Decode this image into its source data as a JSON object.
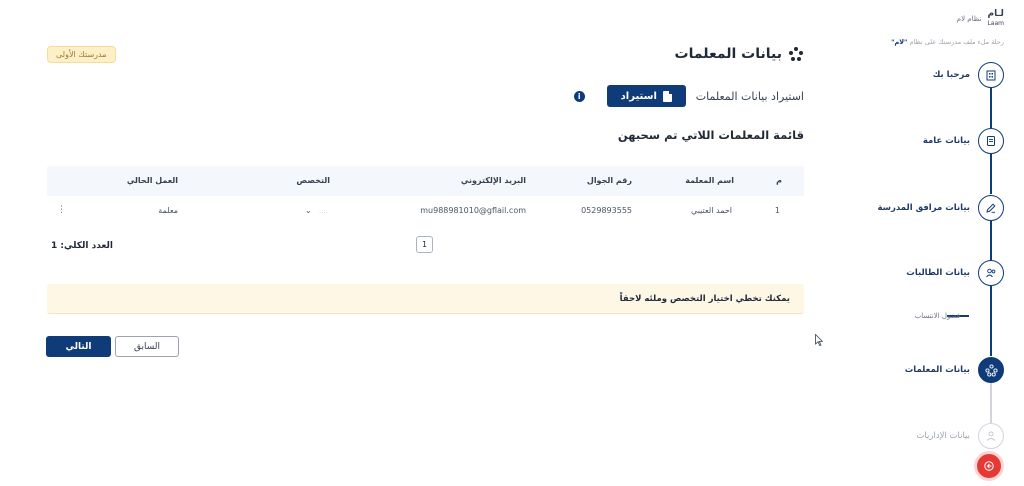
{
  "header": {
    "school_badge": "مدرستك الأولى",
    "page_title": "بيانات المعلمات"
  },
  "import": {
    "label": "استيراد بيانات المعلمات",
    "button": "استيراد"
  },
  "list_title": "قائمة المعلمات اللاتي تم سحبهن",
  "table": {
    "headers": {
      "index": "م",
      "name": "اسم المعلمة",
      "mobile": "رقم الجوال",
      "email": "البريد الإلكتروني",
      "specialty": "التخصص",
      "current_job": "العمل الحالي"
    },
    "rows": [
      {
        "index": "1",
        "name": "احمد العتيبي",
        "mobile": "0529893555",
        "email": "mu988981010@gflail.com",
        "specialty_placeholder": "....",
        "current_job": "معلمة"
      }
    ]
  },
  "pagination": {
    "total": "العدد الكلي: 1",
    "page": "1"
  },
  "notice": "يمكنك تخطي اختيار التخصص وملئه لاحقاً",
  "actions": {
    "next": "التالي",
    "previous": "السابق"
  },
  "sidebar": {
    "brand_name": "نظام لام",
    "brand_logo": "لـام",
    "brand_logo_sub": "Laam",
    "tagline_prefix": "رحلة ملء ملف مدرستك على نظام",
    "tagline_brand": "\"لام\"",
    "steps": [
      {
        "label": "مرحبا بك",
        "icon": "building-icon"
      },
      {
        "label": "بيانات عامة",
        "icon": "document-icon"
      },
      {
        "label": "بيانات مرافق المدرسة",
        "icon": "pencil-icon"
      },
      {
        "label": "بيانات الطالبات",
        "icon": "users-icon"
      },
      {
        "label": "بيانات المعلمات",
        "icon": "teachers-icon"
      },
      {
        "label": "بيانات الإداريات",
        "icon": "user-icon"
      }
    ],
    "substep": "فصول الانتساب"
  },
  "colors": {
    "primary": "#0f3b78",
    "notice_bg": "#fff7e6",
    "badge_bg": "#fdf0c8",
    "logout": "#e53935"
  }
}
